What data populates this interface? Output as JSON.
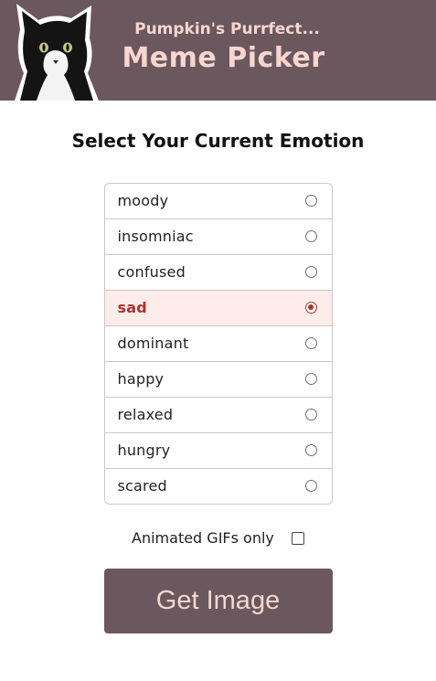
{
  "header": {
    "subtitle": "Pumpkin's Purrfect...",
    "title": "Meme Picker",
    "mascot_icon": "tuxedo-cat-photo"
  },
  "heading": "Select Your Current Emotion",
  "emotions": [
    {
      "label": "moody",
      "selected": false
    },
    {
      "label": "insomniac",
      "selected": false
    },
    {
      "label": "confused",
      "selected": false
    },
    {
      "label": "sad",
      "selected": true
    },
    {
      "label": "dominant",
      "selected": false
    },
    {
      "label": "happy",
      "selected": false
    },
    {
      "label": "relaxed",
      "selected": false
    },
    {
      "label": "hungry",
      "selected": false
    },
    {
      "label": "scared",
      "selected": false
    }
  ],
  "gif_option": {
    "label": "Animated GIFs only",
    "checked": false
  },
  "button": {
    "label": "Get Image"
  },
  "colors": {
    "header_bg": "#6b585e",
    "header_text": "#f6d6cf",
    "selected_bg": "#fdecea",
    "selected_text": "#b0312c"
  }
}
